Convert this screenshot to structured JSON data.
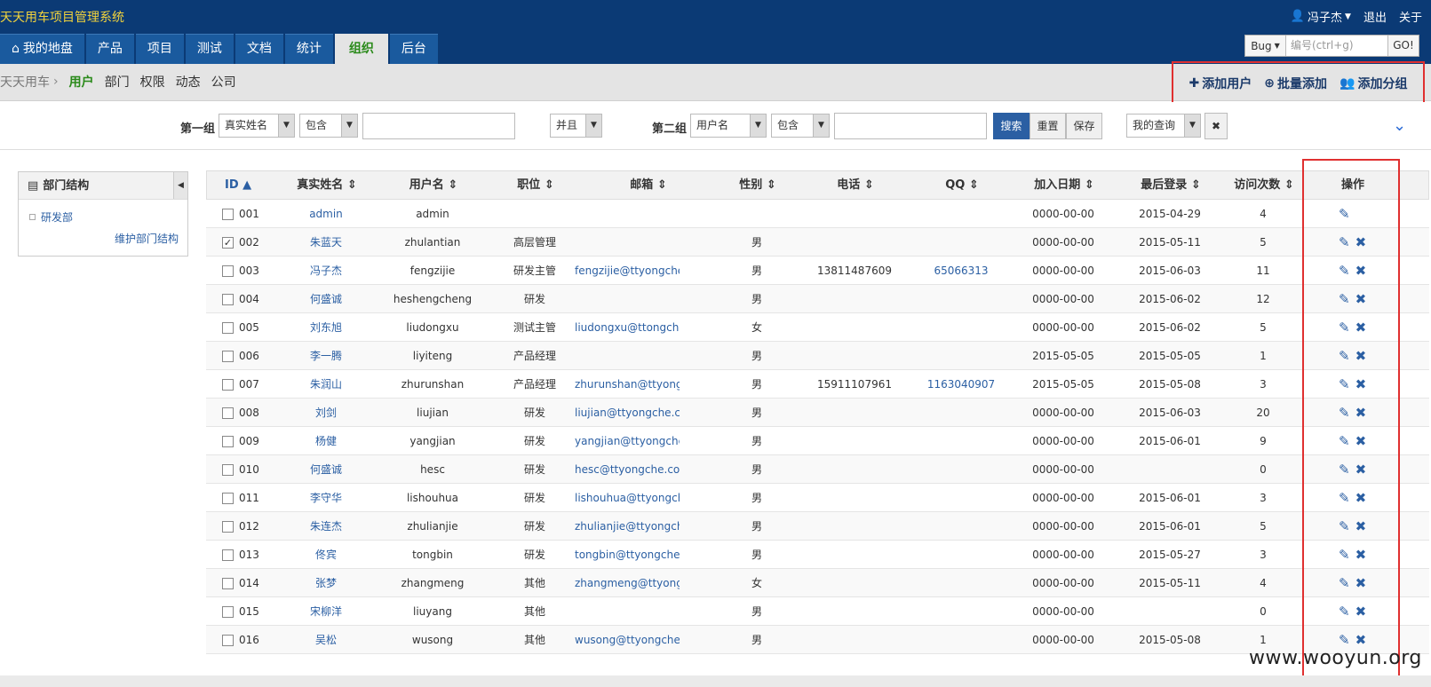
{
  "app": {
    "title": "天天用车项目管理系统"
  },
  "topbar": {
    "user": "冯子杰",
    "logout": "退出",
    "about": "关于"
  },
  "nav": {
    "tabs": [
      {
        "label": "我的地盘",
        "icon": "home-icon"
      },
      {
        "label": "产品"
      },
      {
        "label": "项目"
      },
      {
        "label": "测试"
      },
      {
        "label": "文档"
      },
      {
        "label": "统计"
      },
      {
        "label": "组织",
        "active": true
      },
      {
        "label": "后台"
      }
    ]
  },
  "search": {
    "type": "Bug",
    "placeholder": "编号(ctrl+g)",
    "go": "GO!"
  },
  "subnav": {
    "root": "天天用车",
    "items": [
      "用户",
      "部门",
      "权限",
      "动态",
      "公司"
    ],
    "active": "用户"
  },
  "actions": {
    "add_user": "添加用户",
    "batch_add": "批量添加",
    "add_group": "添加分组"
  },
  "query": {
    "group1_label": "第一组",
    "group1_field": "真实姓名",
    "group1_op": "包含",
    "logic": "并且",
    "group2_label": "第二组",
    "group2_field": "用户名",
    "group2_op": "包含",
    "search": "搜索",
    "reset": "重置",
    "save": "保存",
    "my_query": "我的查询"
  },
  "sidebar": {
    "title": "部门结构",
    "dept": "研发部",
    "maintain": "维护部门结构"
  },
  "table": {
    "headers": [
      "ID",
      "真实姓名",
      "用户名",
      "职位",
      "邮箱",
      "性别",
      "电话",
      "QQ",
      "加入日期",
      "最后登录",
      "访问次数",
      "操作"
    ],
    "rows": [
      {
        "id": "001",
        "name": "admin",
        "user": "admin",
        "role": "",
        "email": "",
        "sex": "",
        "phone": "",
        "qq": "",
        "join": "0000-00-00",
        "last": "2015-04-29",
        "visits": "4",
        "checked": false,
        "deletable": false
      },
      {
        "id": "002",
        "name": "朱蓝天",
        "user": "zhulantian",
        "role": "高层管理",
        "email": "",
        "sex": "男",
        "phone": "",
        "qq": "",
        "join": "0000-00-00",
        "last": "2015-05-11",
        "visits": "5",
        "checked": true,
        "deletable": true
      },
      {
        "id": "003",
        "name": "冯子杰",
        "user": "fengzijie",
        "role": "研发主管",
        "email": "fengzijie@ttyongche",
        "sex": "男",
        "phone": "13811487609",
        "qq": "65066313",
        "join": "0000-00-00",
        "last": "2015-06-03",
        "visits": "11",
        "checked": false,
        "deletable": true
      },
      {
        "id": "004",
        "name": "何盛诚",
        "user": "heshengcheng",
        "role": "研发",
        "email": "",
        "sex": "男",
        "phone": "",
        "qq": "",
        "join": "0000-00-00",
        "last": "2015-06-02",
        "visits": "12",
        "checked": false,
        "deletable": true
      },
      {
        "id": "005",
        "name": "刘东旭",
        "user": "liudongxu",
        "role": "测试主管",
        "email": "liudongxu@ttongche",
        "sex": "女",
        "phone": "",
        "qq": "",
        "join": "0000-00-00",
        "last": "2015-06-02",
        "visits": "5",
        "checked": false,
        "deletable": true
      },
      {
        "id": "006",
        "name": "李一腾",
        "user": "liyiteng",
        "role": "产品经理",
        "email": "",
        "sex": "男",
        "phone": "",
        "qq": "",
        "join": "2015-05-05",
        "last": "2015-05-05",
        "visits": "1",
        "checked": false,
        "deletable": true
      },
      {
        "id": "007",
        "name": "朱润山",
        "user": "zhurunshan",
        "role": "产品经理",
        "email": "zhurunshan@ttyong",
        "sex": "男",
        "phone": "15911107961",
        "qq": "1163040907",
        "join": "2015-05-05",
        "last": "2015-05-08",
        "visits": "3",
        "checked": false,
        "deletable": true
      },
      {
        "id": "008",
        "name": "刘剑",
        "user": "liujian",
        "role": "研发",
        "email": "liujian@ttyongche.c",
        "sex": "男",
        "phone": "",
        "qq": "",
        "join": "0000-00-00",
        "last": "2015-06-03",
        "visits": "20",
        "checked": false,
        "deletable": true
      },
      {
        "id": "009",
        "name": "杨健",
        "user": "yangjian",
        "role": "研发",
        "email": "yangjian@ttyongche",
        "sex": "男",
        "phone": "",
        "qq": "",
        "join": "0000-00-00",
        "last": "2015-06-01",
        "visits": "9",
        "checked": false,
        "deletable": true
      },
      {
        "id": "010",
        "name": "何盛诚",
        "user": "hesc",
        "role": "研发",
        "email": "hesc@ttyongche.co",
        "sex": "男",
        "phone": "",
        "qq": "",
        "join": "0000-00-00",
        "last": "",
        "visits": "0",
        "checked": false,
        "deletable": true
      },
      {
        "id": "011",
        "name": "李守华",
        "user": "lishouhua",
        "role": "研发",
        "email": "lishouhua@ttyongch",
        "sex": "男",
        "phone": "",
        "qq": "",
        "join": "0000-00-00",
        "last": "2015-06-01",
        "visits": "3",
        "checked": false,
        "deletable": true
      },
      {
        "id": "012",
        "name": "朱连杰",
        "user": "zhulianjie",
        "role": "研发",
        "email": "zhulianjie@ttyongch",
        "sex": "男",
        "phone": "",
        "qq": "",
        "join": "0000-00-00",
        "last": "2015-06-01",
        "visits": "5",
        "checked": false,
        "deletable": true
      },
      {
        "id": "013",
        "name": "佟宾",
        "user": "tongbin",
        "role": "研发",
        "email": "tongbin@ttyongche.",
        "sex": "男",
        "phone": "",
        "qq": "",
        "join": "0000-00-00",
        "last": "2015-05-27",
        "visits": "3",
        "checked": false,
        "deletable": true
      },
      {
        "id": "014",
        "name": "张梦",
        "user": "zhangmeng",
        "role": "其他",
        "email": "zhangmeng@ttyong",
        "sex": "女",
        "phone": "",
        "qq": "",
        "join": "0000-00-00",
        "last": "2015-05-11",
        "visits": "4",
        "checked": false,
        "deletable": true
      },
      {
        "id": "015",
        "name": "宋柳洋",
        "user": "liuyang",
        "role": "其他",
        "email": "",
        "sex": "男",
        "phone": "",
        "qq": "",
        "join": "0000-00-00",
        "last": "",
        "visits": "0",
        "checked": false,
        "deletable": true
      },
      {
        "id": "016",
        "name": "吴松",
        "user": "wusong",
        "role": "其他",
        "email": "wusong@ttyongche",
        "sex": "男",
        "phone": "",
        "qq": "",
        "join": "0000-00-00",
        "last": "2015-05-08",
        "visits": "1",
        "checked": false,
        "deletable": true
      }
    ]
  },
  "watermark": "www.wooyun.org",
  "colors": {
    "header": "#0b3a75",
    "nav_tab": "#1a5a9e",
    "active_green": "#2a8a1a",
    "link": "#2b5fa3",
    "highlight_red": "#e03030",
    "title_yellow": "#f2d33c"
  }
}
